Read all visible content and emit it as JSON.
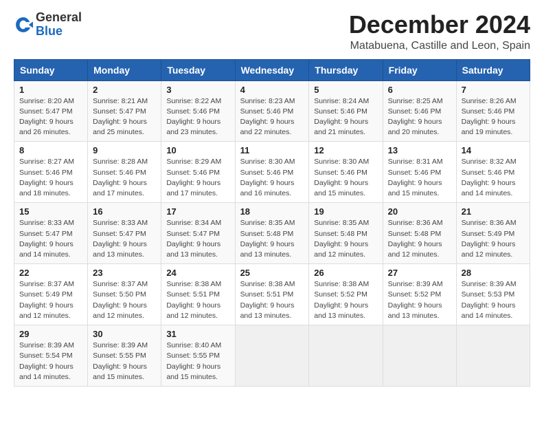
{
  "logo": {
    "general": "General",
    "blue": "Blue"
  },
  "header": {
    "month": "December 2024",
    "location": "Matabuena, Castille and Leon, Spain"
  },
  "weekdays": [
    "Sunday",
    "Monday",
    "Tuesday",
    "Wednesday",
    "Thursday",
    "Friday",
    "Saturday"
  ],
  "weeks": [
    [
      {
        "day": "1",
        "sunrise": "8:20 AM",
        "sunset": "5:47 PM",
        "daylight": "9 hours and 26 minutes."
      },
      {
        "day": "2",
        "sunrise": "8:21 AM",
        "sunset": "5:47 PM",
        "daylight": "9 hours and 25 minutes."
      },
      {
        "day": "3",
        "sunrise": "8:22 AM",
        "sunset": "5:46 PM",
        "daylight": "9 hours and 23 minutes."
      },
      {
        "day": "4",
        "sunrise": "8:23 AM",
        "sunset": "5:46 PM",
        "daylight": "9 hours and 22 minutes."
      },
      {
        "day": "5",
        "sunrise": "8:24 AM",
        "sunset": "5:46 PM",
        "daylight": "9 hours and 21 minutes."
      },
      {
        "day": "6",
        "sunrise": "8:25 AM",
        "sunset": "5:46 PM",
        "daylight": "9 hours and 20 minutes."
      },
      {
        "day": "7",
        "sunrise": "8:26 AM",
        "sunset": "5:46 PM",
        "daylight": "9 hours and 19 minutes."
      }
    ],
    [
      {
        "day": "8",
        "sunrise": "8:27 AM",
        "sunset": "5:46 PM",
        "daylight": "9 hours and 18 minutes."
      },
      {
        "day": "9",
        "sunrise": "8:28 AM",
        "sunset": "5:46 PM",
        "daylight": "9 hours and 17 minutes."
      },
      {
        "day": "10",
        "sunrise": "8:29 AM",
        "sunset": "5:46 PM",
        "daylight": "9 hours and 17 minutes."
      },
      {
        "day": "11",
        "sunrise": "8:30 AM",
        "sunset": "5:46 PM",
        "daylight": "9 hours and 16 minutes."
      },
      {
        "day": "12",
        "sunrise": "8:30 AM",
        "sunset": "5:46 PM",
        "daylight": "9 hours and 15 minutes."
      },
      {
        "day": "13",
        "sunrise": "8:31 AM",
        "sunset": "5:46 PM",
        "daylight": "9 hours and 15 minutes."
      },
      {
        "day": "14",
        "sunrise": "8:32 AM",
        "sunset": "5:46 PM",
        "daylight": "9 hours and 14 minutes."
      }
    ],
    [
      {
        "day": "15",
        "sunrise": "8:33 AM",
        "sunset": "5:47 PM",
        "daylight": "9 hours and 14 minutes."
      },
      {
        "day": "16",
        "sunrise": "8:33 AM",
        "sunset": "5:47 PM",
        "daylight": "9 hours and 13 minutes."
      },
      {
        "day": "17",
        "sunrise": "8:34 AM",
        "sunset": "5:47 PM",
        "daylight": "9 hours and 13 minutes."
      },
      {
        "day": "18",
        "sunrise": "8:35 AM",
        "sunset": "5:48 PM",
        "daylight": "9 hours and 13 minutes."
      },
      {
        "day": "19",
        "sunrise": "8:35 AM",
        "sunset": "5:48 PM",
        "daylight": "9 hours and 12 minutes."
      },
      {
        "day": "20",
        "sunrise": "8:36 AM",
        "sunset": "5:48 PM",
        "daylight": "9 hours and 12 minutes."
      },
      {
        "day": "21",
        "sunrise": "8:36 AM",
        "sunset": "5:49 PM",
        "daylight": "9 hours and 12 minutes."
      }
    ],
    [
      {
        "day": "22",
        "sunrise": "8:37 AM",
        "sunset": "5:49 PM",
        "daylight": "9 hours and 12 minutes."
      },
      {
        "day": "23",
        "sunrise": "8:37 AM",
        "sunset": "5:50 PM",
        "daylight": "9 hours and 12 minutes."
      },
      {
        "day": "24",
        "sunrise": "8:38 AM",
        "sunset": "5:51 PM",
        "daylight": "9 hours and 12 minutes."
      },
      {
        "day": "25",
        "sunrise": "8:38 AM",
        "sunset": "5:51 PM",
        "daylight": "9 hours and 13 minutes."
      },
      {
        "day": "26",
        "sunrise": "8:38 AM",
        "sunset": "5:52 PM",
        "daylight": "9 hours and 13 minutes."
      },
      {
        "day": "27",
        "sunrise": "8:39 AM",
        "sunset": "5:52 PM",
        "daylight": "9 hours and 13 minutes."
      },
      {
        "day": "28",
        "sunrise": "8:39 AM",
        "sunset": "5:53 PM",
        "daylight": "9 hours and 14 minutes."
      }
    ],
    [
      {
        "day": "29",
        "sunrise": "8:39 AM",
        "sunset": "5:54 PM",
        "daylight": "9 hours and 14 minutes."
      },
      {
        "day": "30",
        "sunrise": "8:39 AM",
        "sunset": "5:55 PM",
        "daylight": "9 hours and 15 minutes."
      },
      {
        "day": "31",
        "sunrise": "8:40 AM",
        "sunset": "5:55 PM",
        "daylight": "9 hours and 15 minutes."
      },
      null,
      null,
      null,
      null
    ]
  ],
  "labels": {
    "sunrise": "Sunrise:",
    "sunset": "Sunset:",
    "daylight": "Daylight:"
  }
}
